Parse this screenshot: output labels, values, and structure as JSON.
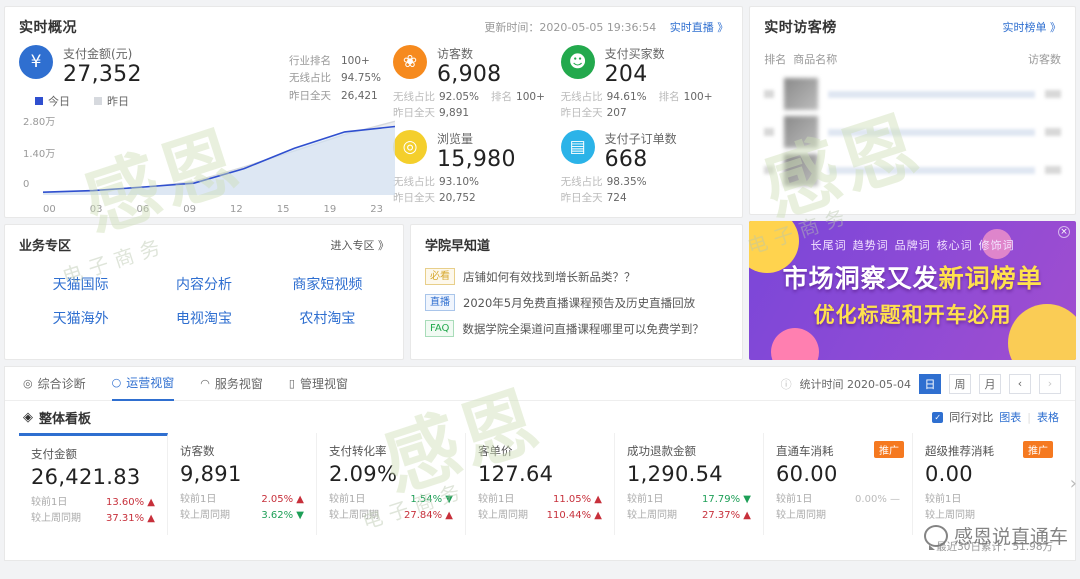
{
  "realtime": {
    "title": "实时概况",
    "update_label": "更新时间：2020-05-05 19:36:54",
    "live_link": "实时直播 》",
    "primary": {
      "label": "支付金额(元)",
      "value": "27,352",
      "rows": [
        {
          "key": "行业排名",
          "val": "100+"
        },
        {
          "key": "无线占比",
          "val": "94.75%"
        },
        {
          "key": "昨日全天",
          "val": "26,421"
        }
      ]
    },
    "metrics": [
      {
        "icon": "footprint-icon",
        "color": "orange",
        "label": "访客数",
        "value": "6,908",
        "wireless_key": "无线占比",
        "wireless": "92.05%",
        "rank_key": "排名",
        "rank": "100+",
        "yesterday_key": "昨日全天",
        "yesterday": "9,891"
      },
      {
        "icon": "user-icon",
        "color": "green",
        "label": "支付买家数",
        "value": "204",
        "wireless_key": "无线占比",
        "wireless": "94.61%",
        "rank_key": "排名",
        "rank": "100+",
        "yesterday_key": "昨日全天",
        "yesterday": "207"
      },
      {
        "icon": "eye-icon",
        "color": "yellow",
        "label": "浏览量",
        "value": "15,980",
        "wireless_key": "无线占比",
        "wireless": "93.10%",
        "rank_key": "",
        "rank": "",
        "yesterday_key": "昨日全天",
        "yesterday": "20,752"
      },
      {
        "icon": "doc-icon",
        "color": "cyan",
        "label": "支付子订单数",
        "value": "668",
        "wireless_key": "无线占比",
        "wireless": "98.35%",
        "rank_key": "",
        "rank": "",
        "yesterday_key": "昨日全天",
        "yesterday": "724"
      }
    ]
  },
  "chart_data": {
    "type": "line",
    "title": "",
    "legend": [
      "今日",
      "昨日"
    ],
    "legend_position": "top-left",
    "x": [
      "00",
      "03",
      "06",
      "09",
      "12",
      "15",
      "19",
      "23"
    ],
    "xlabel": "",
    "ylabel": "",
    "ytick_labels": [
      "2.80万",
      "1.40万",
      "0"
    ],
    "ylim": [
      0,
      28000
    ],
    "grid": false,
    "series": [
      {
        "name": "今日",
        "color": "#2f4fcf",
        "values": [
          300,
          900,
          2200,
          3600,
          9000,
          16500,
          22500,
          24500
        ]
      },
      {
        "name": "昨日",
        "color": "#d6d9de",
        "values": [
          200,
          700,
          2000,
          4200,
          9600,
          15500,
          21500,
          26421
        ]
      }
    ]
  },
  "biz": {
    "title": "业务专区",
    "enter_link": "进入专区 》",
    "links": [
      "天猫国际",
      "内容分析",
      "商家短视频",
      "天猫海外",
      "电视淘宝",
      "农村淘宝"
    ]
  },
  "academy": {
    "title": "学院早知道",
    "items": [
      {
        "tag": "必看",
        "tag_type": "must",
        "text": "店铺如何有效找到增长新品类？？"
      },
      {
        "tag": "直播",
        "tag_type": "live",
        "text": "2020年5月免费直播课程预告及历史直播回放"
      },
      {
        "tag": "FAQ",
        "tag_type": "faq",
        "text": "数据学院全渠道问直播课程哪里可以免费学到？"
      }
    ]
  },
  "rank": {
    "title": "实时访客榜",
    "link": "实时榜单 》",
    "col_rank": "排名",
    "col_item": "商品名称",
    "col_visitors": "访客数",
    "rows": 3
  },
  "banner": {
    "tags": [
      "长尾词",
      "趋势词",
      "品牌词",
      "核心词",
      "修饰词"
    ],
    "line1_a": "市场洞察又发",
    "line1_b": "新词榜单",
    "line2": "优化标题和开车必用",
    "close": "×"
  },
  "tabs": [
    {
      "label": "综合诊断",
      "icon": "target-icon",
      "active": false
    },
    {
      "label": "运营视窗",
      "icon": "circle-icon",
      "active": true
    },
    {
      "label": "服务视窗",
      "icon": "headset-icon",
      "active": false
    },
    {
      "label": "管理视窗",
      "icon": "book-icon",
      "active": false
    }
  ],
  "toolbar": {
    "info_icon": "info-icon",
    "stat_label": "统计时间 2020-05-04",
    "day": "日",
    "week": "周",
    "month": "月",
    "prev": "‹",
    "next": "›"
  },
  "board": {
    "title": "整体看板",
    "icon": "layers-icon",
    "compare_label": "同行对比",
    "chart_label": "图表",
    "table_label": "表格",
    "cmp_day_label": "较前1日",
    "cmp_week_label": "较上周同期",
    "total_label": "最近30日累计：51.98万",
    "kpis": [
      {
        "label": "支付金额",
        "value": "26,421.83",
        "selected": true,
        "promo": "",
        "day_pct": "13.60%",
        "day_dir": "up",
        "week_pct": "37.31%",
        "week_dir": "up"
      },
      {
        "label": "访客数",
        "value": "9,891",
        "selected": false,
        "promo": "",
        "day_pct": "2.05%",
        "day_dir": "up",
        "week_pct": "3.62%",
        "week_dir": "down"
      },
      {
        "label": "支付转化率",
        "value": "2.09%",
        "selected": false,
        "promo": "",
        "day_pct": "1.54%",
        "day_dir": "down",
        "week_pct": "27.84%",
        "week_dir": "up"
      },
      {
        "label": "客单价",
        "value": "127.64",
        "selected": false,
        "promo": "",
        "day_pct": "11.05%",
        "day_dir": "up",
        "week_pct": "110.44%",
        "week_dir": "up"
      },
      {
        "label": "成功退款金额",
        "value": "1,290.54",
        "selected": false,
        "promo": "",
        "day_pct": "17.79%",
        "day_dir": "down",
        "week_pct": "27.37%",
        "week_dir": "up"
      },
      {
        "label": "直通车消耗",
        "value": "60.00",
        "selected": false,
        "promo": "推广",
        "day_pct": "0.00%",
        "day_dir": "flat",
        "week_pct": "",
        "week_dir": "flat"
      },
      {
        "label": "超级推荐消耗",
        "value": "0.00",
        "selected": false,
        "promo": "推广",
        "day_pct": "",
        "day_dir": "flat",
        "week_pct": "",
        "week_dir": "flat"
      }
    ],
    "next_arrow": "›"
  },
  "watermark": {
    "logo": "感恩",
    "sub": "电子商务",
    "brand": "感恩说直通车"
  }
}
